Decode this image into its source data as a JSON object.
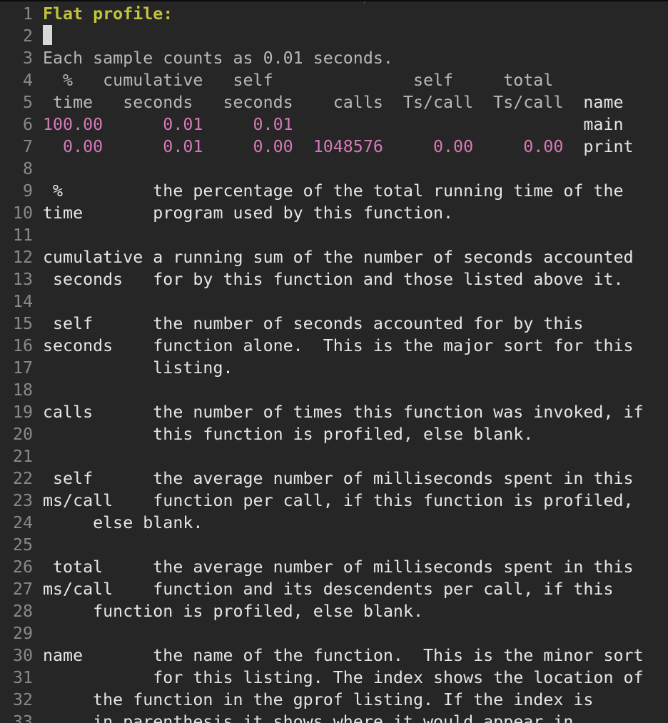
{
  "editor": {
    "lines": [
      {
        "n": "1",
        "segments": [
          {
            "t": "Flat profile:",
            "s": "title"
          }
        ]
      },
      {
        "n": "2",
        "segments": [],
        "cursor": true
      },
      {
        "n": "3",
        "segments": [
          {
            "t": "Each sample counts as 0.01 seconds.",
            "s": "gray"
          }
        ]
      },
      {
        "n": "4",
        "segments": [
          {
            "t": "  %   cumulative   self              self     total",
            "s": "gray"
          }
        ]
      },
      {
        "n": "5",
        "segments": [
          {
            "t": " time   seconds   seconds    calls  Ts/call  Ts/call  ",
            "s": "gray"
          },
          {
            "t": "name",
            "s": "text"
          }
        ]
      },
      {
        "n": "6",
        "segments": [
          {
            "t": "100.00      0.01     0.01                             ",
            "s": "pink"
          },
          {
            "t": "main",
            "s": "text"
          }
        ]
      },
      {
        "n": "7",
        "segments": [
          {
            "t": "  0.00      0.01     0.00  1048576     0.00     0.00  ",
            "s": "pink"
          },
          {
            "t": "print",
            "s": "text"
          }
        ]
      },
      {
        "n": "8",
        "segments": []
      },
      {
        "n": "9",
        "segments": [
          {
            "t": " %         the percentage of the total running time of the",
            "s": "text"
          }
        ]
      },
      {
        "n": "10",
        "segments": [
          {
            "t": "time       program used by this function.",
            "s": "text"
          }
        ]
      },
      {
        "n": "11",
        "segments": []
      },
      {
        "n": "12",
        "segments": [
          {
            "t": "cumulative a running sum of the number of seconds accounted",
            "s": "text"
          }
        ]
      },
      {
        "n": "13",
        "segments": [
          {
            "t": " seconds   for by this function and those listed above it.",
            "s": "text"
          }
        ]
      },
      {
        "n": "14",
        "segments": []
      },
      {
        "n": "15",
        "segments": [
          {
            "t": " self      the number of seconds accounted for by this",
            "s": "text"
          }
        ]
      },
      {
        "n": "16",
        "segments": [
          {
            "t": "seconds    function alone.  This is the major sort for this",
            "s": "text"
          }
        ]
      },
      {
        "n": "17",
        "segments": [
          {
            "t": "           listing.",
            "s": "text"
          }
        ]
      },
      {
        "n": "18",
        "segments": []
      },
      {
        "n": "19",
        "segments": [
          {
            "t": "calls      the number of times this function was invoked, if",
            "s": "text"
          }
        ]
      },
      {
        "n": "20",
        "segments": [
          {
            "t": "           this function is profiled, else blank.",
            "s": "text"
          }
        ]
      },
      {
        "n": "21",
        "segments": []
      },
      {
        "n": "22",
        "segments": [
          {
            "t": " self      the average number of milliseconds spent in this",
            "s": "text"
          }
        ]
      },
      {
        "n": "23",
        "segments": [
          {
            "t": "ms/call    function per call, if this function is profiled,",
            "s": "text"
          }
        ]
      },
      {
        "n": "24",
        "segments": [
          {
            "t": "     else blank.",
            "s": "text"
          }
        ]
      },
      {
        "n": "25",
        "segments": []
      },
      {
        "n": "26",
        "segments": [
          {
            "t": " total     the average number of milliseconds spent in this",
            "s": "text"
          }
        ]
      },
      {
        "n": "27",
        "segments": [
          {
            "t": "ms/call    function and its descendents per call, if this",
            "s": "text"
          }
        ]
      },
      {
        "n": "28",
        "segments": [
          {
            "t": "     function is profiled, else blank.",
            "s": "text"
          }
        ]
      },
      {
        "n": "29",
        "segments": []
      },
      {
        "n": "30",
        "segments": [
          {
            "t": "name       the name of the function.  This is the minor sort",
            "s": "text"
          }
        ]
      },
      {
        "n": "31",
        "segments": [
          {
            "t": "           for this listing. The index shows the location of",
            "s": "text"
          }
        ]
      },
      {
        "n": "32",
        "segments": [
          {
            "t": "     the function in the gprof listing. If the index is",
            "s": "text"
          }
        ]
      },
      {
        "n": "33",
        "segments": [
          {
            "t": "     in parenthesis it shows where it would appear in",
            "s": "text"
          }
        ]
      }
    ]
  }
}
